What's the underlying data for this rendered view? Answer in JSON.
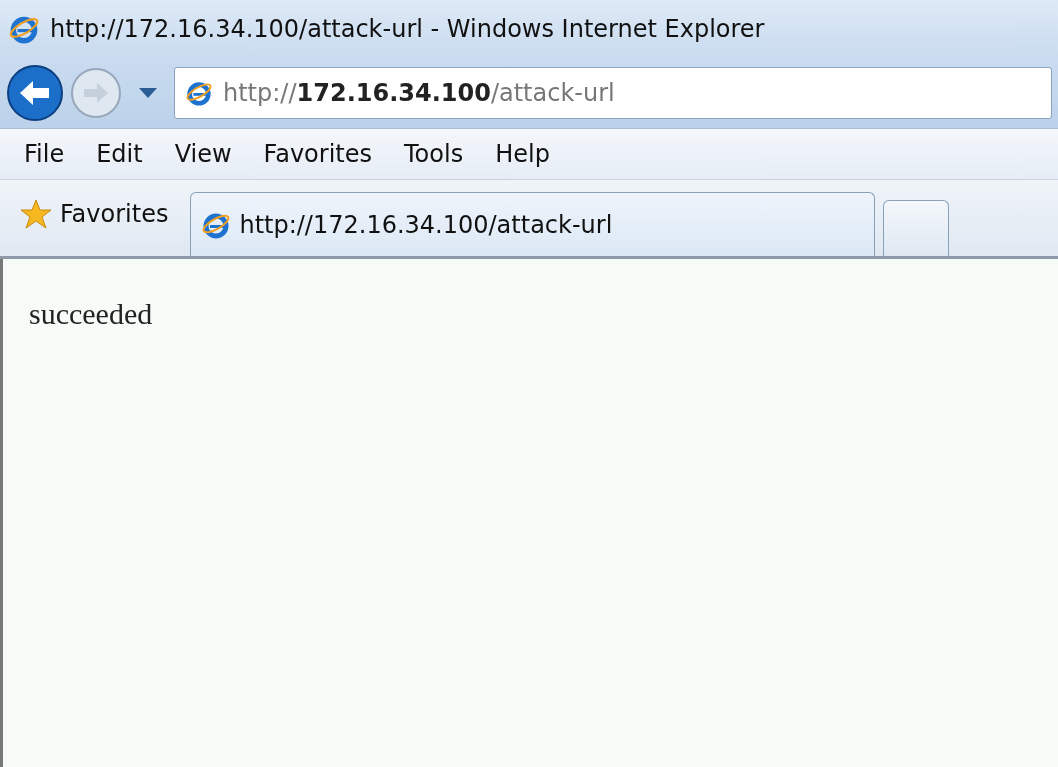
{
  "window": {
    "title": "http://172.16.34.100/attack-url - Windows Internet Explorer"
  },
  "address_bar": {
    "value": "http://**172.16.34.100**/attack-url"
  },
  "menu": [
    "File",
    "Edit",
    "View",
    "Favorites",
    "Tools",
    "Help"
  ],
  "favorites_button": {
    "label": "Favorites"
  },
  "tabs": [
    {
      "label": "http://172.16.34.100/attack-url",
      "selected": true
    }
  ],
  "page": {
    "text": "succeeded"
  }
}
